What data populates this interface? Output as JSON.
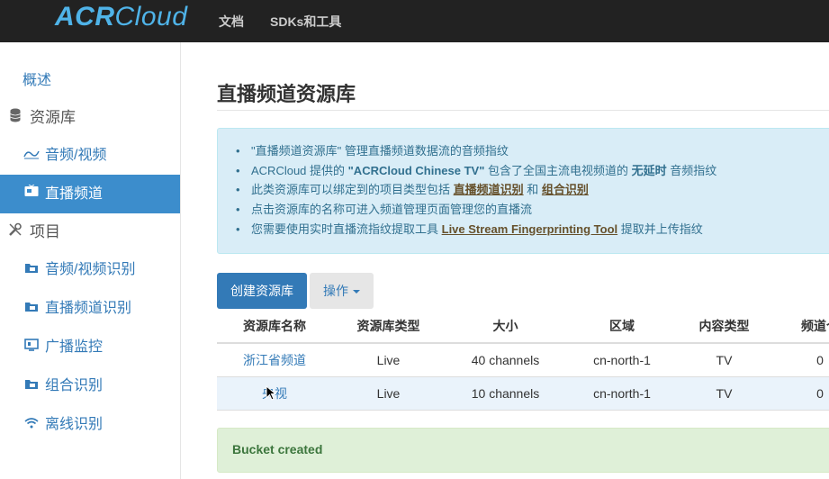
{
  "header": {
    "logo_acr": "ACR",
    "logo_cloud": "Cloud",
    "nav": [
      "文档",
      "SDKs和工具"
    ]
  },
  "sidebar": {
    "overview": "概述",
    "buckets_section": "资源库",
    "buckets": [
      {
        "label": "音频/视频",
        "icon": "waves-icon"
      },
      {
        "label": "直播频道",
        "icon": "tv-icon",
        "active": true
      }
    ],
    "projects_section": "项目",
    "projects": [
      {
        "label": "音频/视频识别",
        "icon": "folder-icon"
      },
      {
        "label": "直播频道识别",
        "icon": "folder-icon"
      },
      {
        "label": "广播监控",
        "icon": "monitor-icon"
      },
      {
        "label": "组合识别",
        "icon": "folder-icon"
      },
      {
        "label": "离线识别",
        "icon": "wifi-icon"
      }
    ]
  },
  "main": {
    "title": "直播频道资源库",
    "info": {
      "line1": "\"直播频道资源库\" 管理直播频道数据流的音频指纹",
      "line2_a": "ACRCloud 提供的 ",
      "line2_b": "\"ACRCloud Chinese TV\"",
      "line2_c": " 包含了全国主流电视频道的 ",
      "line2_d": "无延时",
      "line2_e": " 音频指纹",
      "line3_a": "此类资源库可以绑定到的项目类型包括 ",
      "line3_link1": "直播频道识别",
      "line3_b": " 和 ",
      "line3_link2": "组合识别",
      "line4": "点击资源库的名称可进入频道管理页面管理您的直播流",
      "line5_a": "您需要使用实时直播流指纹提取工具 ",
      "line5_link": "Live Stream Fingerprinting Tool",
      "line5_b": " 提取并上传指纹"
    },
    "create_button": "创建资源库",
    "actions_button": "操作",
    "table": {
      "headers": [
        "资源库名称",
        "资源库类型",
        "大小",
        "区域",
        "内容类型",
        "频道个"
      ],
      "rows": [
        [
          "浙江省频道",
          "Live",
          "40 channels",
          "cn-north-1",
          "TV",
          "0"
        ],
        [
          "央视",
          "Live",
          "10 channels",
          "cn-north-1",
          "TV",
          "0"
        ]
      ]
    },
    "alert": "Bucket created"
  }
}
